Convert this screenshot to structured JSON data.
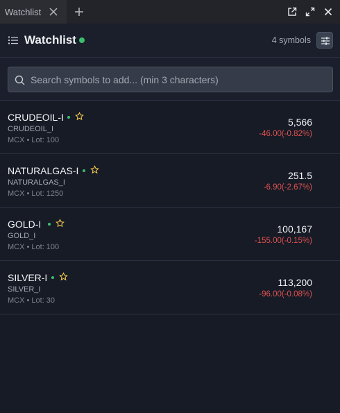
{
  "window": {
    "tab_label": "Watchlist",
    "tab_close_icon": "close-icon",
    "add_tab_icon": "plus-icon",
    "controls": [
      "external-link-icon",
      "expand-icon",
      "close-icon"
    ]
  },
  "header": {
    "title": "Watchlist",
    "status": "connected",
    "status_color": "#3bbf6e",
    "symbol_count": "4 symbols",
    "menu_icon": "list-icon",
    "filter_icon": "sliders-icon"
  },
  "search": {
    "placeholder": "Search symbols to add... (min 3 characters)",
    "value": ""
  },
  "colors": {
    "accent_green": "#3bbf6e",
    "negative_red": "#e0514f",
    "star": "#f2c94c"
  },
  "symbols": [
    {
      "name": "CRUDEOIL-I",
      "code": "CRUDEOIL_I",
      "meta": "MCX • Lot: 100",
      "price": "5,566",
      "change": "-46.00(-0.82%)"
    },
    {
      "name": "NATURALGAS-I",
      "code": "NATURALGAS_I",
      "meta": "MCX • Lot: 1250",
      "price": "251.5",
      "change": "-6.90(-2.67%)"
    },
    {
      "name": "GOLD-I",
      "code": "GOLD_I",
      "meta": "MCX • Lot: 100",
      "price": "100,167",
      "change": "-155.00(-0.15%)"
    },
    {
      "name": "SILVER-I",
      "code": "SILVER_I",
      "meta": "MCX • Lot: 30",
      "price": "113,200",
      "change": "-96.00(-0.08%)"
    }
  ]
}
